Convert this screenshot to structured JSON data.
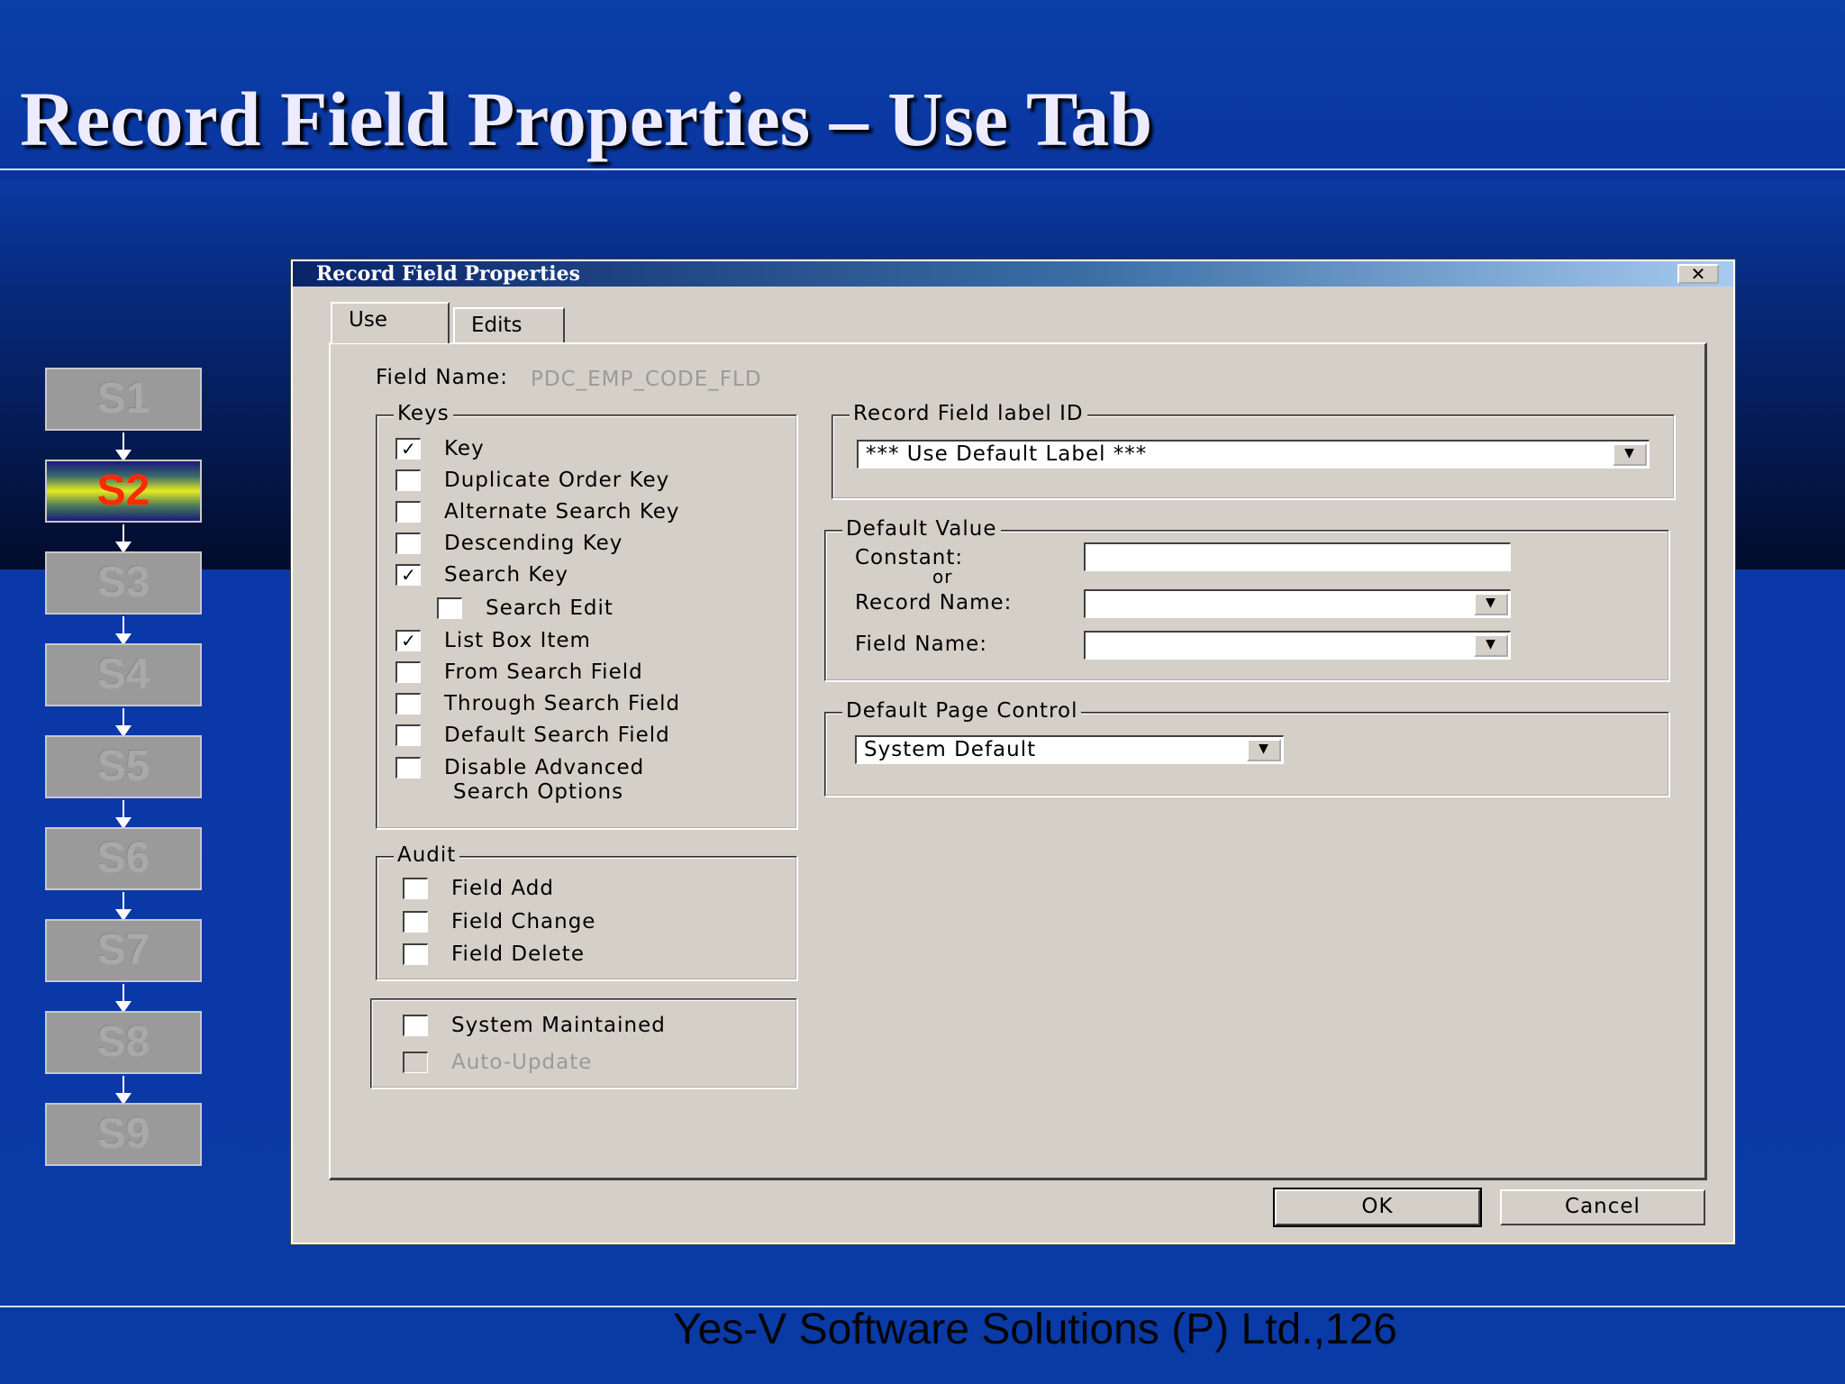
{
  "slide": {
    "title": "Record Field Properties – Use Tab",
    "footer": "Yes-V Software Solutions (P) Ltd.,126"
  },
  "steps": [
    "S1",
    "S2",
    "S3",
    "S4",
    "S5",
    "S6",
    "S7",
    "S8",
    "S9"
  ],
  "active_step": "S2",
  "dialog": {
    "title": "Record Field Properties",
    "close_glyph": "✕",
    "tabs": [
      {
        "label": "Use",
        "selected": true
      },
      {
        "label": "Edits",
        "selected": false
      }
    ],
    "field_name_label": "Field Name:",
    "field_name_value": "PDC_EMP_CODE_FLD",
    "keys": {
      "title": "Keys",
      "items": [
        {
          "label": "Key",
          "checked": true
        },
        {
          "label": "Duplicate Order Key",
          "checked": false
        },
        {
          "label": "Alternate Search Key",
          "checked": false
        },
        {
          "label": "Descending Key",
          "checked": false
        },
        {
          "label": "Search Key",
          "checked": true
        },
        {
          "label": "Search Edit",
          "checked": false
        },
        {
          "label": "List Box Item",
          "checked": true
        },
        {
          "label": "From Search Field",
          "checked": false
        },
        {
          "label": "Through Search Field",
          "checked": false
        },
        {
          "label": "Default Search Field",
          "checked": false
        },
        {
          "label": "Disable Advanced",
          "label2": "Search Options",
          "checked": false
        }
      ]
    },
    "audit": {
      "title": "Audit",
      "items": [
        {
          "label": "Field Add",
          "checked": false
        },
        {
          "label": "Field Change",
          "checked": false
        },
        {
          "label": "Field Delete",
          "checked": false
        }
      ]
    },
    "maintenance": {
      "system_maintained": "System Maintained",
      "auto_update": "Auto-Update"
    },
    "label_id": {
      "title": "Record Field label ID",
      "value": "*** Use Default Label ***"
    },
    "default_value": {
      "title": "Default Value",
      "constant_label": "Constant:",
      "or_label": "or",
      "record_name_label": "Record Name:",
      "field_name_label": "Field Name:",
      "constant_value": "",
      "record_name_value": "",
      "field_name_value": ""
    },
    "page_control": {
      "title": "Default Page Control",
      "value": "System Default"
    },
    "buttons": {
      "ok": "OK",
      "cancel": "Cancel"
    }
  }
}
